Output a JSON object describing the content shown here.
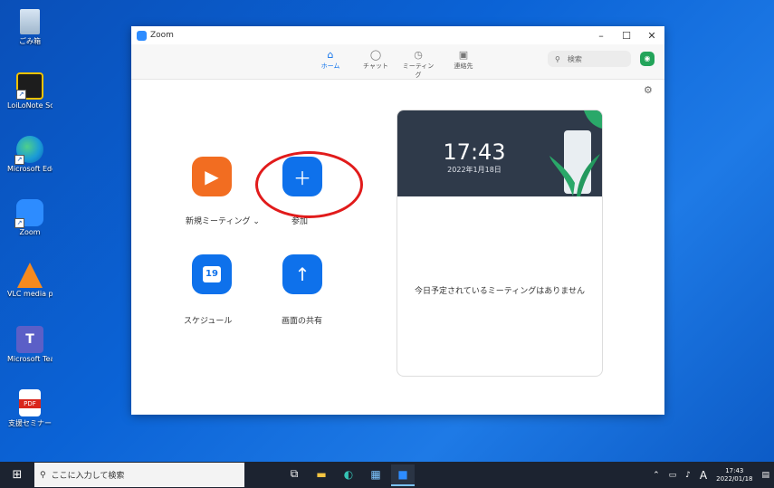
{
  "desktop": {
    "icons": [
      {
        "label": "ごみ箱"
      },
      {
        "label": "LoiLoNote School"
      },
      {
        "label": "Microsoft Edge"
      },
      {
        "label": "Zoom"
      },
      {
        "label": "VLC media player"
      },
      {
        "label": "Microsoft Teams"
      },
      {
        "label": "支援セミナー"
      }
    ]
  },
  "window": {
    "title": "Zoom",
    "controls": {
      "minimize": "–",
      "maximize": "☐",
      "close": "✕"
    }
  },
  "nav": {
    "tabs": [
      {
        "label": "ホーム",
        "active": true
      },
      {
        "label": "チャット"
      },
      {
        "label": "ミーティング"
      },
      {
        "label": "連絡先"
      }
    ],
    "search_placeholder": "検索"
  },
  "actions": {
    "new_meeting": "新規ミーティング",
    "join": "参加",
    "schedule": "スケジュール",
    "schedule_day": "19",
    "share_screen": "画面の共有"
  },
  "card": {
    "time": "17:43",
    "date": "2022年1月18日",
    "empty_message": "今日予定されているミーティングはありません"
  },
  "taskbar": {
    "search_placeholder": "ここに入力して検索",
    "ime": "A",
    "time": "17:43",
    "date": "2022/01/18"
  },
  "colors": {
    "accent": "#0e71eb",
    "orange": "#f26d21",
    "annotation": "#e11b1b"
  }
}
